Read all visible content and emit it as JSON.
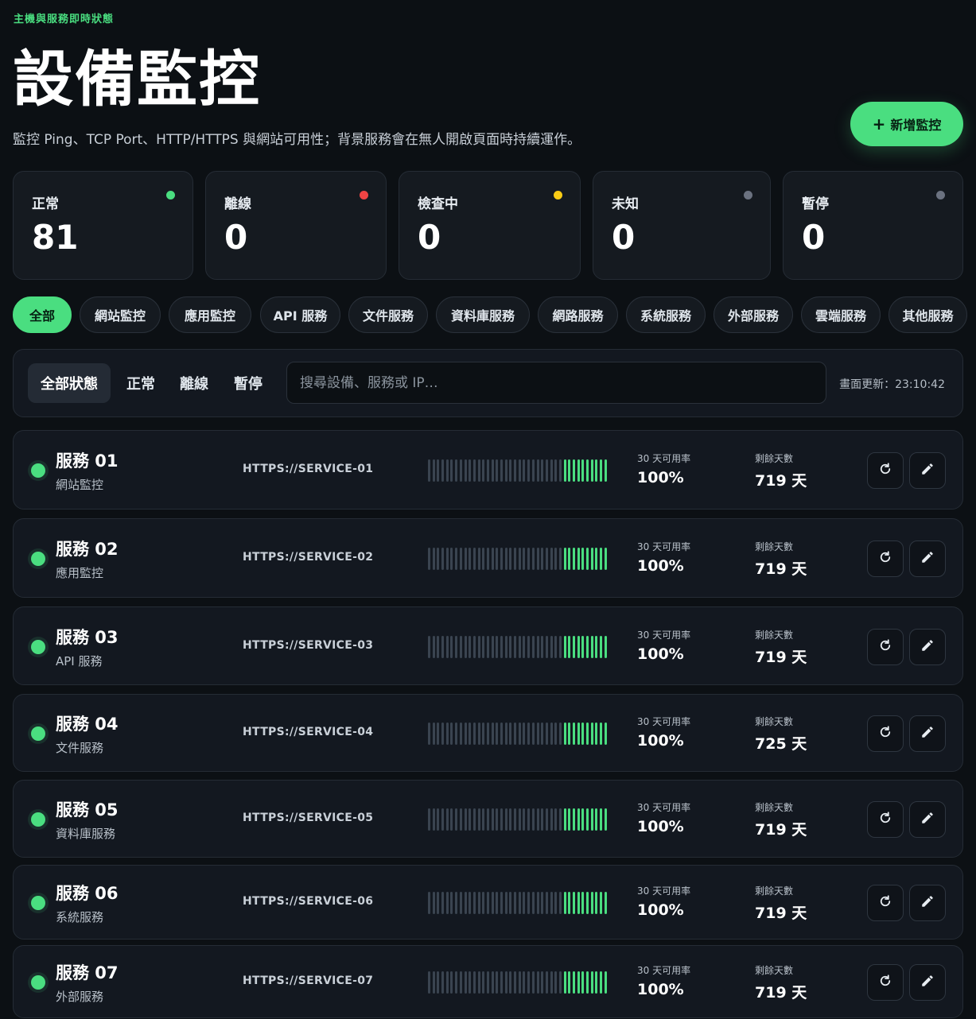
{
  "header": {
    "eyebrow": "主機與服務即時狀態",
    "title": "設備監控",
    "subtitle": "監控 Ping、TCP Port、HTTP/HTTPS 與網站可用性；背景服務會在無人開啟頁面時持續運作。",
    "add_button": "新增監控",
    "add_icon": "plus-icon"
  },
  "stats": [
    {
      "label": "正常",
      "value": "81",
      "color": "#4ade80"
    },
    {
      "label": "離線",
      "value": "0",
      "color": "#ef4444"
    },
    {
      "label": "檢查中",
      "value": "0",
      "color": "#facc15"
    },
    {
      "label": "未知",
      "value": "0",
      "color": "#6b7280"
    },
    {
      "label": "暫停",
      "value": "0",
      "color": "#6b7280"
    }
  ],
  "categories": {
    "active": "全部",
    "items": [
      "全部",
      "網站監控",
      "應用監控",
      "API 服務",
      "文件服務",
      "資料庫服務",
      "網路服務",
      "系統服務",
      "外部服務",
      "雲端服務",
      "其他服務"
    ]
  },
  "filter": {
    "status_tabs": [
      "全部狀態",
      "正常",
      "離線",
      "暫停"
    ],
    "active_status": "全部狀態",
    "search_placeholder": "搜尋設備、服務或 IP…",
    "updated": "畫面更新：23:10:42"
  },
  "monitors": {
    "uptime_label": "30 天可用率",
    "days_label": "剩餘天數",
    "history_total": 40,
    "history_up_recent": 10,
    "refresh_icon": "refresh-icon",
    "edit_icon": "pencil-icon",
    "items": [
      {
        "name": "服務 01",
        "category": "網站監控",
        "url": "HTTPS://SERVICE-01",
        "uptime": "100%",
        "days": "719 天"
      },
      {
        "name": "服務 02",
        "category": "應用監控",
        "url": "HTTPS://SERVICE-02",
        "uptime": "100%",
        "days": "719 天"
      },
      {
        "name": "服務 03",
        "category": "API 服務",
        "url": "HTTPS://SERVICE-03",
        "uptime": "100%",
        "days": "719 天"
      },
      {
        "name": "服務 04",
        "category": "文件服務",
        "url": "HTTPS://SERVICE-04",
        "uptime": "100%",
        "days": "725 天"
      },
      {
        "name": "服務 05",
        "category": "資料庫服務",
        "url": "HTTPS://SERVICE-05",
        "uptime": "100%",
        "days": "719 天"
      },
      {
        "name": "服務 06",
        "category": "系統服務",
        "url": "HTTPS://SERVICE-06",
        "uptime": "100%",
        "days": "719 天"
      },
      {
        "name": "服務 07",
        "category": "外部服務",
        "url": "HTTPS://SERVICE-07",
        "uptime": "100%",
        "days": "719 天"
      }
    ]
  }
}
